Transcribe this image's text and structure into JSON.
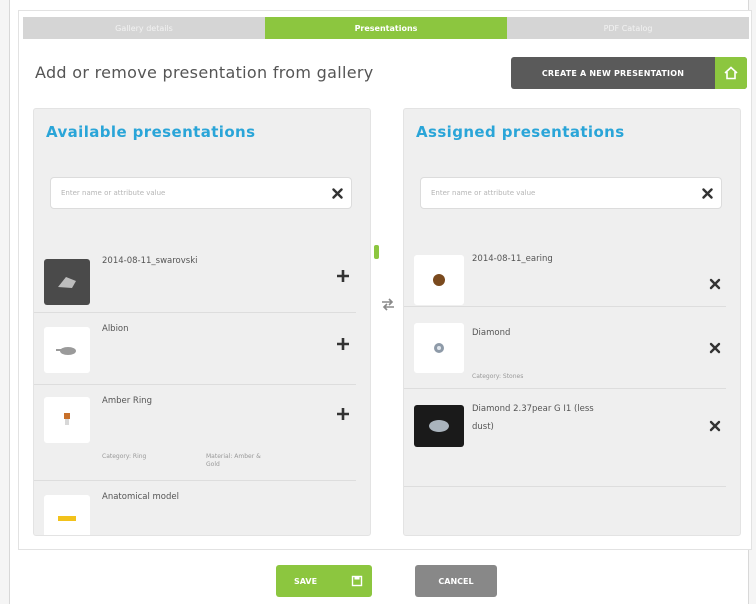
{
  "tabs": [
    "Gallery details",
    "Presentations",
    "PDF Catalog"
  ],
  "heading": "Add or remove presentation from gallery",
  "create_button": "CREATE A NEW PRESENTATION",
  "available": {
    "title": "Available presentations",
    "search_placeholder": "Enter name or attribute value",
    "items": [
      {
        "name": "2014-08-11_swarovski",
        "category": "",
        "material": ""
      },
      {
        "name": "Albion",
        "category": "",
        "material": ""
      },
      {
        "name": "Amber Ring",
        "category": "Category: Ring",
        "material": "Material: Amber & Gold"
      },
      {
        "name": "Anatomical model",
        "category": "",
        "material": ""
      }
    ]
  },
  "assigned": {
    "title": "Assigned presentations",
    "search_placeholder": "Enter name or attribute value",
    "items": [
      {
        "name": "2014-08-11_earing",
        "category": ""
      },
      {
        "name": "Diamond",
        "category": "Category: Stones"
      },
      {
        "name": "Diamond 2.37pear G I1 (less",
        "name2": "dust)",
        "category": ""
      }
    ]
  },
  "footer": {
    "save": "SAVE",
    "cancel": "CANCEL"
  },
  "colors": {
    "accent": "#8cc63f",
    "title_blue": "#2aa5d8",
    "dark_button": "#5a5a5a"
  },
  "icons": {
    "home": "home-icon",
    "close": "close-icon",
    "plus": "plus-icon",
    "swap": "swap-arrows-icon",
    "save": "save-icon"
  }
}
